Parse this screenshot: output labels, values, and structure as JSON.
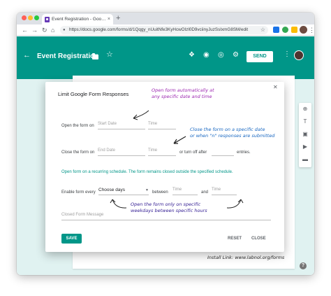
{
  "browser": {
    "tab_title": "Event Registration - Google Fo",
    "tab_close": "×",
    "new_tab": "+",
    "url": "https://docs.google.com/forms/d/1Qqgy_nUuitNfe3KyHcwOIzl0D9vciinyJuzSsIxmG8SM/edit"
  },
  "header": {
    "form_title": "Event Registration",
    "send_label": "SEND"
  },
  "dialog": {
    "title": "Limit Google Form Responses",
    "open_form_on_label": "Open the form on",
    "start_date_placeholder": "Start Date",
    "time_placeholder": "Time",
    "close_form_on_label": "Close the form on",
    "end_date_placeholder": "End Date",
    "or_turn_off_after_label": "or turn off after",
    "entries_label": "entries.",
    "recurring_hint": "Open form on a recurring schedule. The form remains closed outside the specified schedule.",
    "enable_form_every_label": "Enable form every",
    "choose_days_value": "Choose days",
    "between_label": "between",
    "and_label": "and",
    "closed_form_message_placeholder": "Closed Form Message",
    "save_label": "SAVE",
    "reset_label": "RESET",
    "close_label": "CLOSE"
  },
  "annotations": {
    "open_note_line1": "Open form automatically at",
    "open_note_line2": "any specific date and time",
    "close_note_line1": "Close the form on a specific date",
    "close_note_line2": "or when \"n\" responses are submitted",
    "weekday_note_line1": "Open the form only on specific",
    "weekday_note_line2": "weekdays between specific hours",
    "install_link": "Install Link: www.labnol.org/forms"
  },
  "colors": {
    "header_teal": "#009688",
    "purple_note": "#9c27b0",
    "blue_note": "#1565c0",
    "navy_note": "#311b92"
  },
  "icons": {
    "back": "arrow-left-icon",
    "folder": "folder-icon",
    "star": "star-icon",
    "addons": "puzzle-icon",
    "palette": "palette-icon",
    "preview": "eye-icon",
    "settings": "gear-icon",
    "more": "more-vert-icon"
  }
}
